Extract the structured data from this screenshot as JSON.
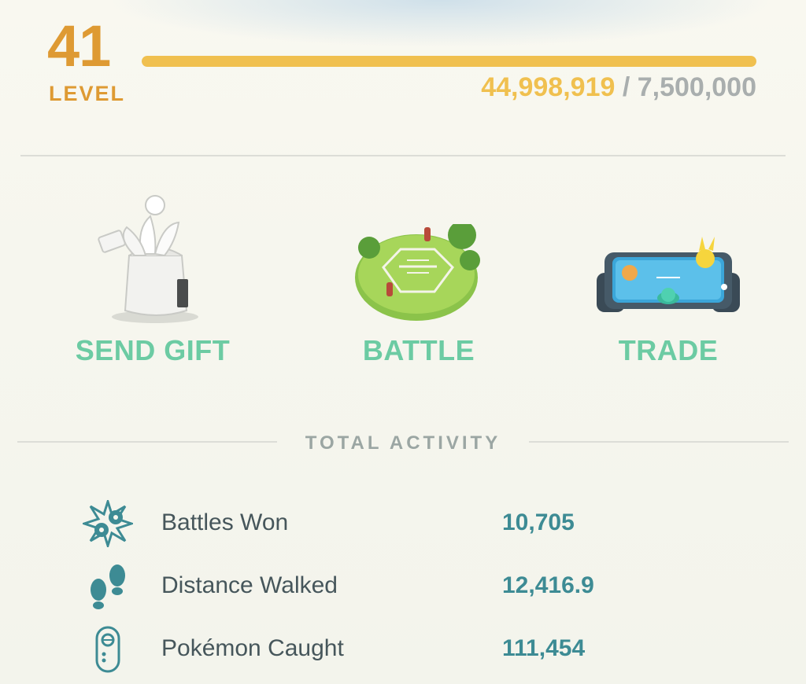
{
  "level": {
    "number": "41",
    "label": "LEVEL"
  },
  "xp": {
    "current": "44,998,919",
    "separator": " / ",
    "goal": "7,500,000",
    "progress_fraction": 1.0
  },
  "actions": [
    {
      "label": "SEND GIFT",
      "icon": "gift-icon"
    },
    {
      "label": "BATTLE",
      "icon": "battle-arena-icon"
    },
    {
      "label": "TRADE",
      "icon": "trade-device-icon"
    }
  ],
  "activity": {
    "title": "TOTAL ACTIVITY",
    "rows": [
      {
        "label": "Battles Won",
        "value": "10,705",
        "icon": "battles-won-icon"
      },
      {
        "label": "Distance Walked",
        "value": "12,416.9",
        "icon": "footprints-icon"
      },
      {
        "label": "Pokémon Caught",
        "value": "111,454",
        "icon": "pokeball-capsule-icon"
      }
    ]
  },
  "colors": {
    "level_orange": "#de9a33",
    "xp_yellow": "#f0c04f",
    "action_green": "#6ccba3",
    "stat_teal": "#3d8b94",
    "muted_gray": "#a9aeae"
  }
}
